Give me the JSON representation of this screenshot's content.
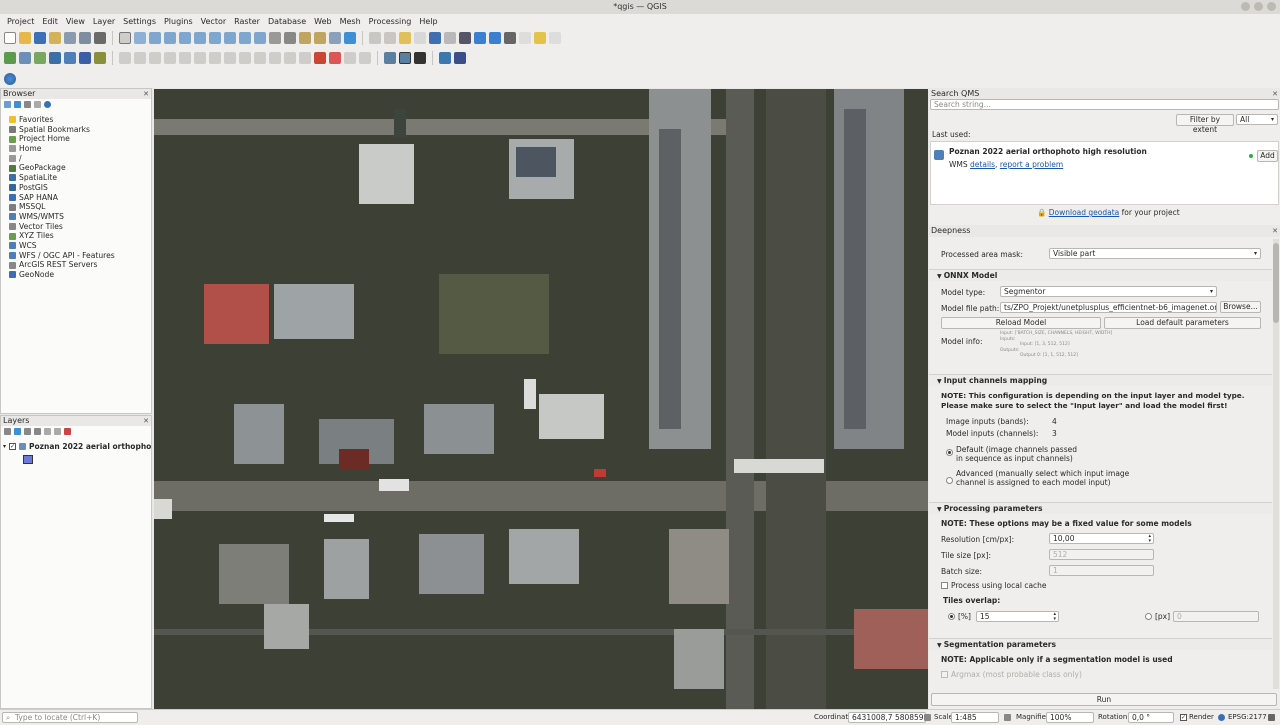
{
  "window": {
    "title": "*qgis — QGIS"
  },
  "menu": [
    "Project",
    "Edit",
    "View",
    "Layer",
    "Settings",
    "Plugins",
    "Vector",
    "Raster",
    "Database",
    "Web",
    "Mesh",
    "Processing",
    "Help"
  ],
  "browser": {
    "title": "Browser",
    "items": [
      "Favorites",
      "Spatial Bookmarks",
      "Project Home",
      "Home",
      "/",
      "GeoPackage",
      "SpatiaLite",
      "PostGIS",
      "SAP HANA",
      "MSSQL",
      "WMS/WMTS",
      "Vector Tiles",
      "XYZ Tiles",
      "WCS",
      "WFS / OGC API - Features",
      "ArcGIS REST Servers",
      "GeoNode"
    ]
  },
  "layers": {
    "title": "Layers",
    "items": [
      {
        "name": "Poznan 2022 aerial orthophoto h",
        "checked": true
      }
    ]
  },
  "qms": {
    "title": "Search QMS",
    "search_placeholder": "Search string...",
    "filter_button": "Filter by extent",
    "filter_select": "All",
    "last_used_label": "Last used:",
    "result_title": "Poznan 2022 aerial orthophoto high resolution",
    "result_type": "WMS",
    "details_link": "details",
    "report_link": "report a problem",
    "add_button": "Add",
    "download_link": "Download geodata",
    "download_suffix": "for your project"
  },
  "deepness": {
    "title": "Deepness",
    "area_mask_label": "Processed area mask:",
    "area_mask_value": "Visible part",
    "onnx_section": "ONNX Model",
    "model_type_label": "Model type:",
    "model_type_value": "Segmentor",
    "model_path_label": "Model file path:",
    "model_path_value": "ts/ZPO_Projekt/unetplusplus_efficientnet-b6_imagenet.onnx",
    "browse_button": "Browse...",
    "reload_button": "Reload Model",
    "load_default_button": "Load default parameters",
    "model_info_label": "Model info:",
    "model_info_lines": [
      "Input: ['BATCH_SIZE, CHANNELS, HEIGHT, WIDTH]",
      "Inputs:",
      "Input: [1, 3, 512, 512]",
      "Outputs:",
      "Output 0: [1, 1, 512, 512]"
    ],
    "channels_section": "Input channels mapping",
    "channels_note": "NOTE: This configuration is depending on the input layer and model type. Please make sure to select the \"Input layer\" and load the model first!",
    "image_inputs_label": "Image inputs (bands):",
    "image_inputs_value": "4",
    "model_inputs_label": "Model inputs (channels):",
    "model_inputs_value": "3",
    "default_option_l1": "Default (image channels passed",
    "default_option_l2": "in sequence as input channels)",
    "advanced_option_l1": "Advanced (manually select which input image",
    "advanced_option_l2": "channel is assigned to each model input)",
    "processing_section": "Processing parameters",
    "processing_note": "NOTE: These options may be a fixed value for some models",
    "resolution_label": "Resolution [cm/px]:",
    "resolution_value": "10,00",
    "tile_size_label": "Tile size [px]:",
    "tile_size_value": "512",
    "batch_size_label": "Batch size:",
    "batch_size_value": "1",
    "cache_label": "Process using local cache",
    "overlap_label": "Tiles overlap:",
    "overlap_pct_label": "[%]",
    "overlap_pct_value": "15",
    "overlap_px_label": "[px]",
    "overlap_px_value": "0",
    "segmentation_section": "Segmentation parameters",
    "segmentation_note": "NOTE: Applicable only if a segmentation model is used",
    "argmax_label": "Argmax (most probable class only)",
    "run_button": "Run"
  },
  "status": {
    "locate_placeholder": "Type to locate (Ctrl+K)",
    "coordinate_label": "Coordinate",
    "coordinate_value": "6431008,7 5808598,7",
    "scale_label": "Scale",
    "scale_value": "1:485",
    "magnifier_label": "Magnifier",
    "magnifier_value": "100%",
    "rotation_label": "Rotation",
    "rotation_value": "0,0 °",
    "render_label": "Render",
    "crs": "EPSG:2177"
  }
}
